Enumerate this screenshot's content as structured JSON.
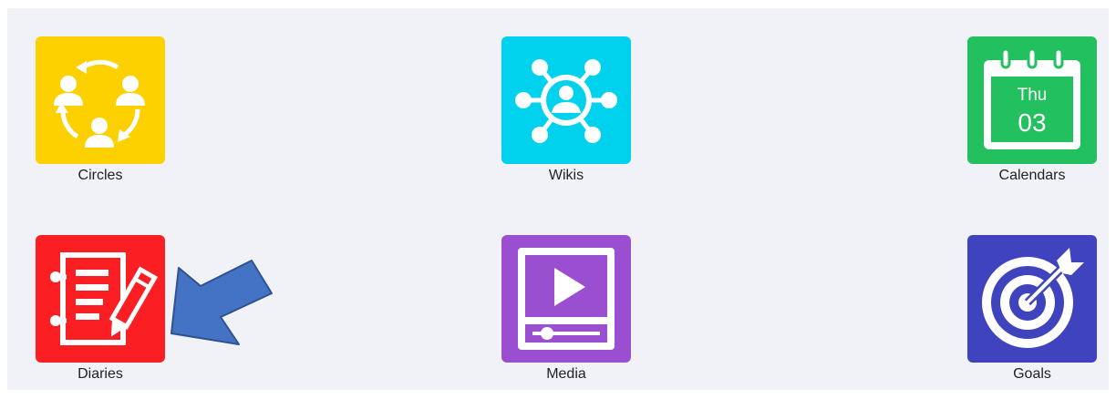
{
  "apps": [
    {
      "label": "Circles",
      "icon": "circles-icon",
      "color": "#fdd000"
    },
    {
      "label": "Wikis",
      "icon": "wikis-icon",
      "color": "#00d2ee"
    },
    {
      "label": "Calendars",
      "icon": "calendar-icon",
      "color": "#23c060",
      "day": "Thu",
      "date": "03"
    },
    {
      "label": "Diaries",
      "icon": "diary-icon",
      "color": "#fb1e22"
    },
    {
      "label": "Media",
      "icon": "media-play-icon",
      "color": "#9a4fd1"
    },
    {
      "label": "Goals",
      "icon": "target-icon",
      "color": "#3f43bd"
    }
  ],
  "annotation": {
    "icon": "pointer-arrow-icon",
    "color": "#4472c4"
  }
}
